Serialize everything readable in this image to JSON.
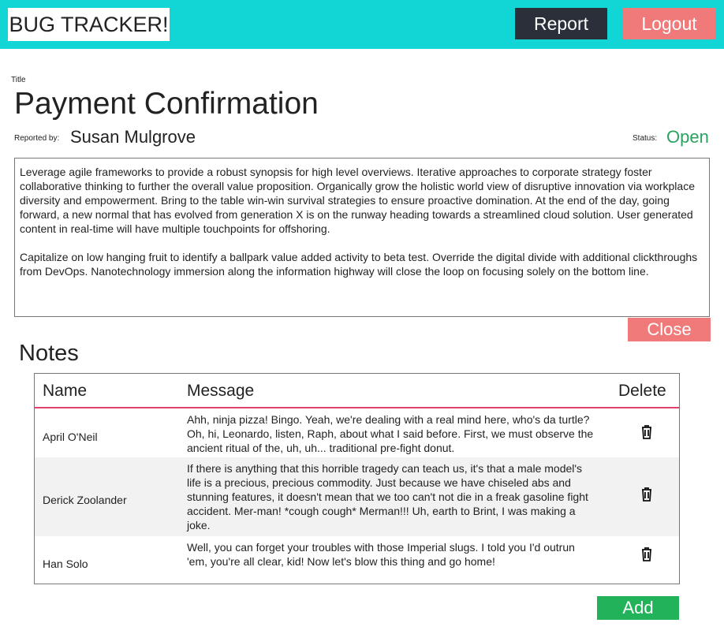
{
  "header": {
    "logo": "BUG TRACKER!",
    "report": "Report",
    "logout": "Logout"
  },
  "bug": {
    "title_label": "Title",
    "title": "Payment Confirmation",
    "reported_label": "Reported by:",
    "reporter": "Susan Mulgrove",
    "status_label": "Status:",
    "status": "Open",
    "description": "Leverage agile frameworks to provide a robust synopsis for high level overviews. Iterative approaches to corporate strategy foster collaborative thinking to further the overall value proposition. Organically grow the holistic world view of disruptive innovation via workplace diversity and empowerment. Bring to the table win-win survival strategies to ensure proactive domination. At the end of the day, going forward, a new normal that has evolved from generation X is on the runway heading towards a streamlined cloud solution. User generated content in real-time will have multiple touchpoints for offshoring.\n\nCapitalize on low hanging fruit to identify a ballpark value added activity to beta test. Override the digital divide with additional clickthroughs from DevOps. Nanotechnology immersion along the information highway will close the loop on focusing solely on the bottom line.",
    "close": "Close"
  },
  "notes": {
    "heading": "Notes",
    "columns": [
      "Name",
      "Message",
      "Delete"
    ],
    "rows": [
      {
        "name": "April O'Neil",
        "message": "Ahh, ninja pizza! Bingo. Yeah, we're dealing with a real mind here, who's da turtle? Oh, hi, Leonardo, listen, Raph, about what I said before. First, we must observe the ancient ritual of the, uh, uh... traditional pre-fight donut.",
        "delete_icon": "trash-icon"
      },
      {
        "name": "Derick Zoolander",
        "message": "If there is anything that this horrible tragedy can teach us, it's that a male model's life is a precious, precious commodity. Just because we have chiseled abs and stunning features, it doesn't mean that we too can't not die in a freak gasoline fight accident. Mer-man! *cough cough* Merman!!! Uh, earth to Brint, I was making a joke.",
        "delete_icon": "trash-icon"
      },
      {
        "name": "Han Solo",
        "message": "Well, you can forget your troubles with those Imperial slugs. I told you I'd outrun 'em, you're all clear, kid! Now let's blow this thing and go home!",
        "delete_icon": "trash-icon"
      }
    ],
    "add": "Add"
  },
  "colors": {
    "header": "#12d6d6",
    "report": "#2b2f3a",
    "logout": "#f07a7a",
    "open": "#2aa260",
    "add": "#22b35a"
  }
}
